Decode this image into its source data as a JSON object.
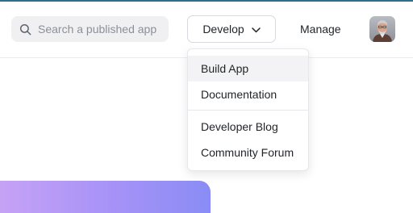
{
  "header": {
    "search": {
      "placeholder": "Search a published app",
      "value": ""
    },
    "develop_label": "Develop",
    "manage_label": "Manage"
  },
  "develop_menu": {
    "items": [
      {
        "label": "Build App",
        "highlighted": true
      },
      {
        "label": "Documentation",
        "highlighted": false
      },
      {
        "label": "Developer Blog",
        "highlighted": false
      },
      {
        "label": "Community Forum",
        "highlighted": false
      }
    ]
  },
  "icons": {
    "search": "search-icon",
    "develop_chevron": "chevron-down-icon",
    "avatar": "user-avatar"
  },
  "colors": {
    "accent_bar": "#2f6f88",
    "search_bg": "#f0f0f3",
    "menu_highlight": "#f3f3f5",
    "card_gradient_start": "#c6a2f5",
    "card_gradient_end": "#8a8cf6"
  }
}
